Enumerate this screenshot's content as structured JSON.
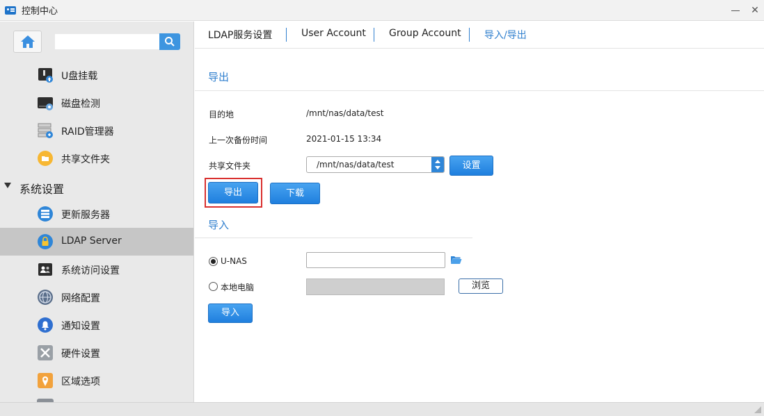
{
  "window": {
    "title": "控制中心"
  },
  "sidebar": {
    "search": {
      "value": "",
      "placeholder": ""
    },
    "items_top": [
      {
        "label": "U盘挂载",
        "icon": "usb-drive-icon"
      },
      {
        "label": "磁盘检测",
        "icon": "disk-check-icon"
      },
      {
        "label": "RAID管理器",
        "icon": "raid-manager-icon"
      },
      {
        "label": "共享文件夹",
        "icon": "shared-folder-icon"
      }
    ],
    "section": {
      "label": "系统设置",
      "expanded": true
    },
    "items_system": [
      {
        "label": "更新服务器",
        "icon": "update-server-icon",
        "active": false
      },
      {
        "label": "LDAP Server",
        "icon": "ldap-lock-icon",
        "active": true
      },
      {
        "label": "系统访问设置",
        "icon": "system-access-icon",
        "active": false
      },
      {
        "label": "网络配置",
        "icon": "network-config-icon",
        "active": false
      },
      {
        "label": "通知设置",
        "icon": "notification-bell-icon",
        "active": false
      },
      {
        "label": "硬件设置",
        "icon": "hardware-tools-icon",
        "active": false
      },
      {
        "label": "区域选项",
        "icon": "region-map-icon",
        "active": false
      }
    ]
  },
  "tabs": [
    {
      "label": "LDAP服务设置",
      "active": false
    },
    {
      "label": "User Account",
      "active": false
    },
    {
      "label": "Group Account",
      "active": false
    },
    {
      "label": "导入/导出",
      "active": true
    }
  ],
  "export": {
    "title": "导出",
    "destination_label": "目的地",
    "destination_value": "/mnt/nas/data/test",
    "last_backup_label": "上一次备份时间",
    "last_backup_value": "2021-01-15 13:34",
    "shared_folder_label": "共享文件夹",
    "shared_folder_value": "/mnt/nas/data/test",
    "settings_button": "设置",
    "export_button": "导出",
    "download_button": "下载"
  },
  "import": {
    "title": "导入",
    "option_unas": "U-NAS",
    "option_local": "本地电脑",
    "selected": "U-NAS",
    "unas_path_value": "",
    "local_path_value": "",
    "browse_button": "浏览",
    "import_button": "导入"
  },
  "colors": {
    "accent": "#2f7fce",
    "highlight": "#d9302f",
    "sidebar_bg": "#e9e9e9",
    "active_item": "#c6c6c6"
  }
}
